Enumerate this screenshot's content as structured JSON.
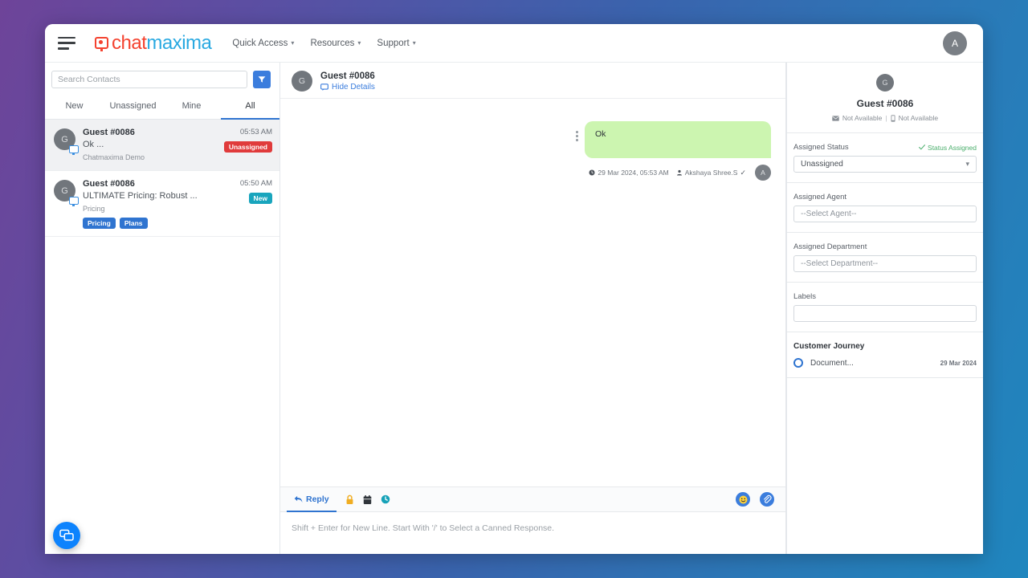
{
  "topbar": {
    "menu_icon": "hamburger-icon",
    "logo_part_a": "chat",
    "logo_part_b": "maxima",
    "nav": [
      {
        "label": "Quick Access",
        "caret": "⌄"
      },
      {
        "label": "Resources",
        "caret": "⌄"
      },
      {
        "label": "Support",
        "caret": "⌄"
      }
    ],
    "avatar_initial": "A"
  },
  "sidebar": {
    "search_placeholder": "Search Contacts",
    "search_value": "",
    "filter_icon": "filter-icon",
    "tabs": [
      {
        "label": "New",
        "active": false
      },
      {
        "label": "Unassigned",
        "active": false
      },
      {
        "label": "Mine",
        "active": false
      },
      {
        "label": "All",
        "active": true
      }
    ],
    "conversations": [
      {
        "avatar_initial": "G",
        "name": "Guest #0086",
        "snippet": "Ok ...",
        "source": "Chatmaxima Demo",
        "time": "05:53 AM",
        "badge": "Unassigned",
        "badge_type": "unassigned",
        "chips": [],
        "selected": true
      },
      {
        "avatar_initial": "G",
        "name": "Guest #0086",
        "snippet": "ULTIMATE Pricing: Robust ...",
        "source": "Pricing",
        "time": "05:50 AM",
        "badge": "New",
        "badge_type": "new",
        "chips": [
          "Pricing",
          "Plans"
        ],
        "selected": false
      }
    ]
  },
  "chat": {
    "header": {
      "avatar_initial": "G",
      "title": "Guest #0086",
      "hide_details_label": "Hide Details"
    },
    "messages": [
      {
        "text": "Ok",
        "timestamp": "29 Mar 2024, 05:53 AM",
        "agent": "Akshaya Shree.S",
        "agent_initial": "A",
        "status_tick": "✓",
        "direction": "outgoing",
        "bubble_color": "#ccf5b0"
      }
    ]
  },
  "composer": {
    "reply_tab_label": "Reply",
    "tool_icons": [
      "lock-icon",
      "calendar-icon",
      "clock-icon"
    ],
    "emoji_icon": "emoji-icon",
    "attachment_icon": "paperclip-icon",
    "input_placeholder": "Shift + Enter for New Line. Start With '/' to Select a Canned Response.",
    "input_value": ""
  },
  "details_panel": {
    "profile": {
      "avatar_initial": "G",
      "name": "Guest #0086",
      "email_status": "Not Available",
      "phone_status": "Not Available",
      "separator": "|"
    },
    "assigned_status": {
      "label": "Assigned Status",
      "status_note": "Status Assigned",
      "value": "Unassigned"
    },
    "assigned_agent": {
      "label": "Assigned Agent",
      "value": "--Select Agent--"
    },
    "assigned_department": {
      "label": "Assigned Department",
      "value": "--Select Department--"
    },
    "labels": {
      "label": "Labels",
      "value": ""
    },
    "customer_journey": {
      "title": "Customer Journey",
      "items": [
        {
          "label": "Document...",
          "date": "29 Mar 2024"
        }
      ]
    }
  },
  "floating_widget": {
    "icon": "chat-bubbles-icon"
  },
  "colors": {
    "accent_blue": "#2f74d0",
    "brand_red": "#f4422f",
    "brand_blue": "#29a9e1",
    "bubble_green": "#ccf5b0",
    "badge_unassigned": "#e03b3b",
    "badge_new": "#19a5bd",
    "status_green": "#4caf6d"
  }
}
